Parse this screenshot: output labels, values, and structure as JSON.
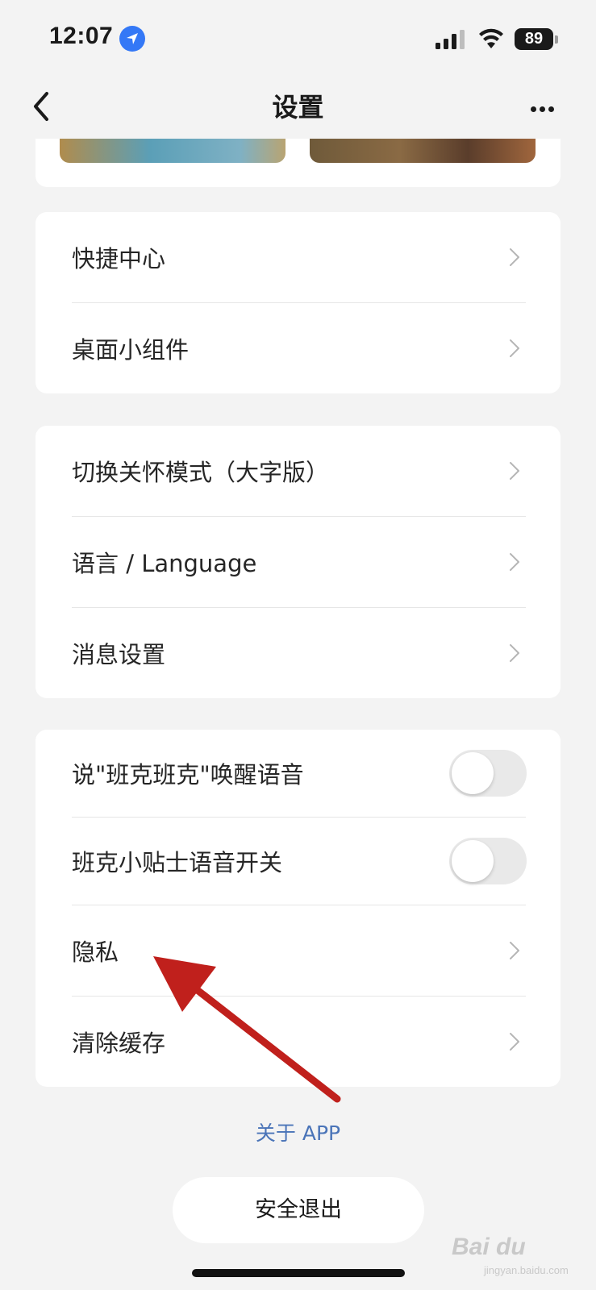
{
  "status_bar": {
    "time": "12:07",
    "battery": "89",
    "icons": [
      "location-icon",
      "signal-icon",
      "wifi-icon",
      "battery-icon"
    ]
  },
  "nav": {
    "title": "设置",
    "back_icon": "chevron-left-icon",
    "more_icon": "more-dots-icon"
  },
  "sections": [
    {
      "items": [
        {
          "label": "快捷中心",
          "type": "link"
        },
        {
          "label": "桌面小组件",
          "type": "link"
        }
      ]
    },
    {
      "items": [
        {
          "label": "切换关怀模式（大字版）",
          "type": "link"
        },
        {
          "label": "语言 / Language",
          "type": "link"
        },
        {
          "label": "消息设置",
          "type": "link"
        }
      ]
    },
    {
      "items": [
        {
          "label": "说\"班克班克\"唤醒语音",
          "type": "toggle",
          "on": false
        },
        {
          "label": "班克小贴士语音开关",
          "type": "toggle",
          "on": false
        },
        {
          "label": "隐私",
          "type": "link"
        },
        {
          "label": "清除缓存",
          "type": "link"
        }
      ]
    }
  ],
  "about_link": "关于 APP",
  "logout_button": "安全退出",
  "annotation": {
    "color": "#c0201c"
  },
  "colors": {
    "accent_link": "#4a74b8",
    "background": "#f3f3f3"
  }
}
